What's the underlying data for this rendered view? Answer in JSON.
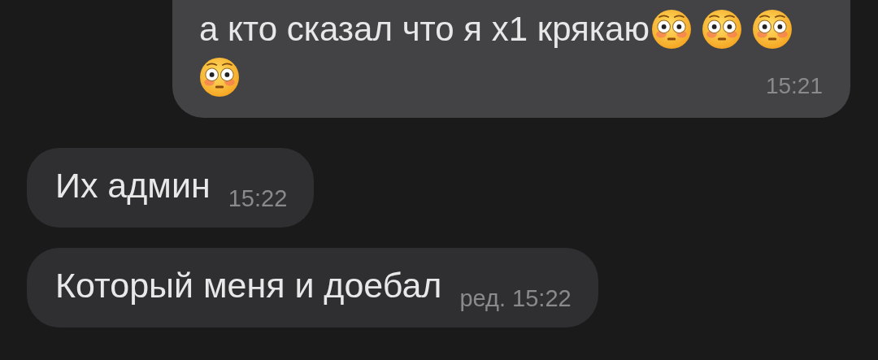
{
  "messages": [
    {
      "kind": "outgoing",
      "text": "а кто сказал что я x1 крякаю",
      "emojis": [
        {
          "kind": "flushed"
        },
        {
          "kind": "flushed"
        },
        {
          "kind": "flushed"
        },
        {
          "kind": "flushed"
        }
      ],
      "time": "15:21"
    },
    {
      "kind": "incoming",
      "text": "Их админ",
      "time": "15:22"
    },
    {
      "kind": "incoming",
      "text": "Который меня и доебал",
      "time": "ред. 15:22"
    }
  ]
}
